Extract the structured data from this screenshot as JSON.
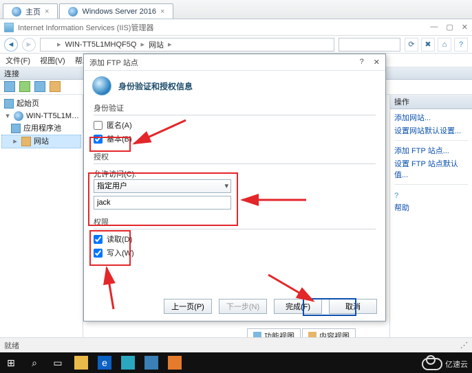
{
  "tabs": {
    "home": "主页",
    "server": "Windows Server 2016"
  },
  "title_row": "Internet Information Services (IIS)管理器",
  "breadcrumb": {
    "root_icon": "globe",
    "server": "WIN-TT5L1MHQF5Q",
    "node": "网站"
  },
  "menus": {
    "file": "文件(F)",
    "view": "视图(V)",
    "help": "帮助(H)"
  },
  "connections": {
    "header": "连接"
  },
  "tree": {
    "start": "起始页",
    "server": "WIN-TT5L1MHQF5Q",
    "apppools": "应用程序池",
    "sites": "网站"
  },
  "actions": {
    "header": "操作",
    "add_website": "添加网站...",
    "set_website_default": "设置网站默认设置...",
    "add_ftp": "添加 FTP 站点...",
    "set_ftp_default": "设置 FTP 站点默认值...",
    "help": "帮助"
  },
  "viewtabs": {
    "features": "功能视图",
    "content": "内容视图"
  },
  "dialog": {
    "title": "添加 FTP 站点",
    "heading": "身份验证和授权信息",
    "auth_group": "身份验证",
    "anon": "匿名(A)",
    "basic": "基本(B)",
    "authz_group": "授权",
    "allow_access_label": "允许访问(C):",
    "allow_access_value": "指定用户",
    "user_value": "jack",
    "perm_group": "权限",
    "read": "读取(D)",
    "write": "写入(W)",
    "prev": "上一页(P)",
    "next": "下一步(N)",
    "finish": "完成(F)",
    "cancel": "取消"
  },
  "status": {
    "ready": "就绪"
  },
  "logo": "亿速云"
}
